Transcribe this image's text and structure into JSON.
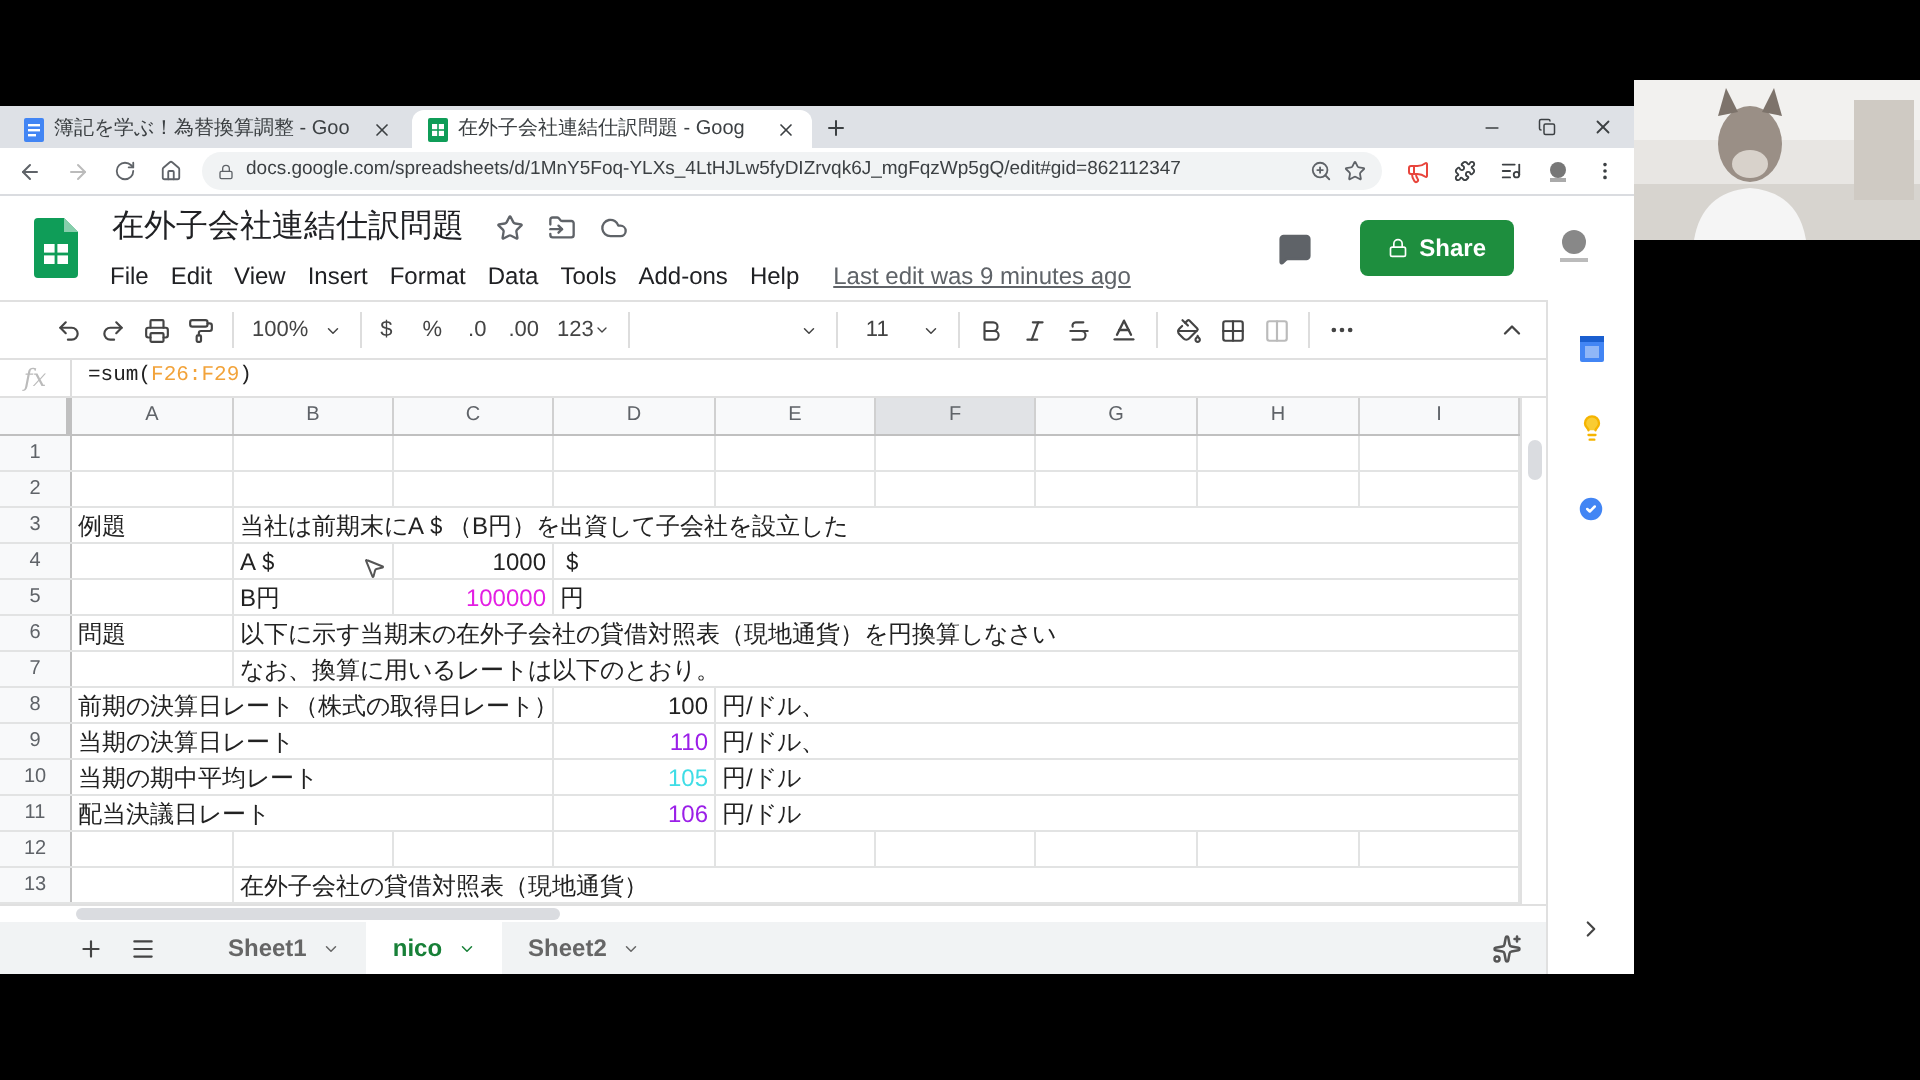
{
  "browser": {
    "tabs": [
      {
        "title": "簿記を学ぶ！為替換算調整 - Goo",
        "kind": "docs",
        "selected": false
      },
      {
        "title": "在外子会社連結仕訳問題 - Goog",
        "kind": "sheets",
        "selected": true
      }
    ],
    "url": "docs.google.com/spreadsheets/d/1MnY5Foq-YLXs_4LtHJLw5fyDIZrvqk6J_mgFqzWp5gQ/edit#gid=862112347"
  },
  "document": {
    "title": "在外子会社連結仕訳問題",
    "menu": [
      "File",
      "Edit",
      "View",
      "Insert",
      "Format",
      "Data",
      "Tools",
      "Add-ons",
      "Help"
    ],
    "last_edit": "Last edit was 9 minutes ago",
    "share": "Share"
  },
  "toolbar": {
    "zoom": "100%",
    "currency": "$",
    "percent": "%",
    "decrease_decimals": ".0",
    "increase_decimals": ".00",
    "number_format": "123",
    "font_size": "11"
  },
  "formula_bar": {
    "label": "fx",
    "formula": [
      {
        "text": "=sum("
      },
      {
        "text": "F26:F29",
        "kind": "range"
      },
      {
        "text": ")"
      }
    ]
  },
  "columns": [
    {
      "label": "A",
      "selected": false
    },
    {
      "label": "B",
      "selected": false
    },
    {
      "label": "C",
      "selected": false
    },
    {
      "label": "D",
      "selected": false
    },
    {
      "label": "E",
      "selected": false
    },
    {
      "label": "F",
      "selected": true
    },
    {
      "label": "G",
      "selected": false
    },
    {
      "label": "H",
      "selected": false
    },
    {
      "label": "I",
      "selected": false
    }
  ],
  "rows": [
    {
      "number": "1"
    },
    {
      "number": "2"
    },
    {
      "number": "3",
      "a": {
        "text": "例題"
      },
      "b": {
        "text": "当社は前期末にA＄（B円）を出資して子会社を設立した"
      }
    },
    {
      "number": "4",
      "b": {
        "text": "A＄"
      },
      "c": {
        "text": "1000",
        "kind": "number"
      },
      "d": {
        "text": "＄"
      }
    },
    {
      "number": "5",
      "b": {
        "text": "B円"
      },
      "c": {
        "text": "100000",
        "kind": "number",
        "color": "#e31ee3"
      },
      "d": {
        "text": "円"
      }
    },
    {
      "number": "6",
      "a": {
        "text": "問題"
      },
      "b": {
        "text": "以下に示す当期末の在外子会社の貸借対照表（現地通貨）を円換算しなさい"
      }
    },
    {
      "number": "7",
      "b": {
        "text": "なお、換算に用いるレートは以下のとおり。"
      }
    },
    {
      "number": "8",
      "a": {
        "text": "前期の決算日レート（株式の取得日レート）"
      },
      "d": {
        "text": "100",
        "kind": "number"
      },
      "e": {
        "text": "円/ドル、"
      }
    },
    {
      "number": "9",
      "a": {
        "text": "当期の決算日レート"
      },
      "d": {
        "text": "110",
        "kind": "number",
        "color": "#9b1fe8"
      },
      "e": {
        "text": "円/ドル、"
      }
    },
    {
      "number": "10",
      "a": {
        "text": "当期の期中平均レート"
      },
      "d": {
        "text": "105",
        "kind": "number",
        "color": "#3fdde6"
      },
      "e": {
        "text": "円/ドル"
      }
    },
    {
      "number": "11",
      "a": {
        "text": "配当決議日レート"
      },
      "d": {
        "text": "106",
        "kind": "number",
        "color": "#9b1fe8"
      },
      "e": {
        "text": "円/ドル"
      }
    },
    {
      "number": "12"
    },
    {
      "number": "13",
      "b": {
        "text": "在外子会社の貸借対照表（現地通貨）"
      }
    }
  ],
  "sheets": [
    {
      "name": "Sheet1",
      "selected": false
    },
    {
      "name": "nico",
      "selected": true
    },
    {
      "name": "Sheet2",
      "selected": false
    }
  ]
}
